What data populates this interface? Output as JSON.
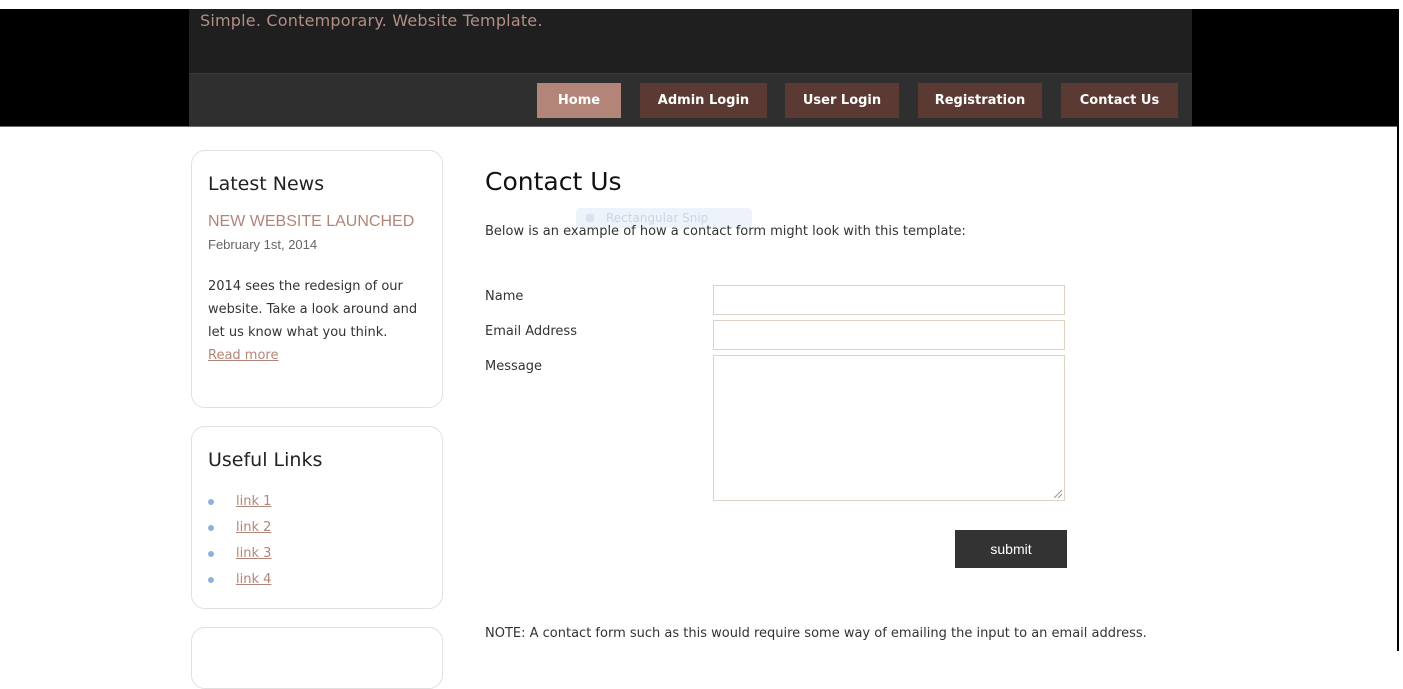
{
  "header": {
    "slogan": "Simple. Contemporary. Website Template.",
    "nav": [
      {
        "label": "Home",
        "active": true
      },
      {
        "label": "Admin Login"
      },
      {
        "label": "User Login"
      },
      {
        "label": "Registration"
      },
      {
        "label": "Contact Us"
      }
    ]
  },
  "sidebar": {
    "news": {
      "title": "Latest News",
      "headline": "NEW WEBSITE LAUNCHED",
      "date": "February 1st, 2014",
      "text": "2014 sees the redesign of our website. Take a look around and let us know what you think.",
      "read_more": "Read more"
    },
    "links": {
      "title": "Useful Links",
      "items": [
        "link 1",
        "link 2",
        "link 3",
        "link 4"
      ]
    }
  },
  "main": {
    "title": "Contact Us",
    "intro": "Below is an example of how a contact form might look with this template:",
    "ghost_label": "Rectangular Snip",
    "form": {
      "name_label": "Name",
      "name_value": "",
      "email_label": "Email Address",
      "email_value": "",
      "message_label": "Message",
      "message_value": "",
      "submit_label": "submit"
    },
    "note": "NOTE: A contact form such as this would require some way of emailing the input to an email address."
  },
  "colors": {
    "accent": "#b38579",
    "nav_bg": "#5a3a33",
    "header_bg": "#1f1f1f"
  }
}
